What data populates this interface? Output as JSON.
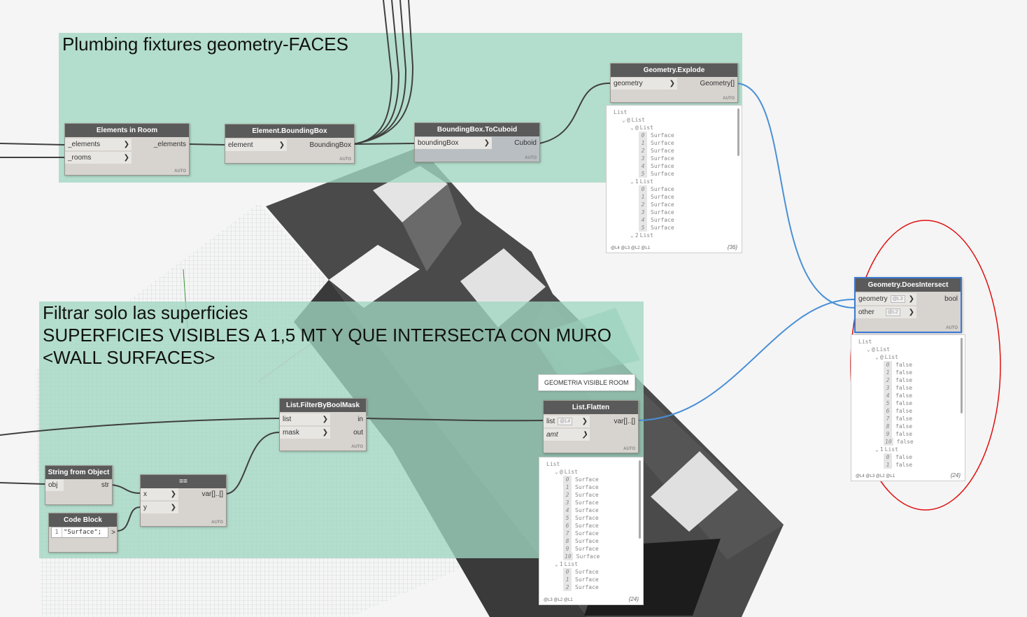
{
  "groups": {
    "top": {
      "title": "Plumbing fixtures geometry-FACES",
      "color": "#a0d6c2"
    },
    "bottom": {
      "title": "Filtrar solo las superficies\nSUPERFICIES VISIBLES A 1,5 MT Y QUE INTERSECTA CON MURO\n<WALL SURFACES>",
      "color": "#a0d6c2"
    }
  },
  "nodes": {
    "elements_in_room": {
      "title": "Elements in Room",
      "inputs": [
        "_elements",
        "_rooms"
      ],
      "outputs": [
        "_elements"
      ],
      "lacing": "AUTO"
    },
    "element_bbox": {
      "title": "Element.BoundingBox",
      "inputs": [
        "element"
      ],
      "outputs": [
        "BoundingBox"
      ],
      "lacing": "AUTO"
    },
    "bbox_cuboid": {
      "title": "BoundingBox.ToCuboid",
      "inputs": [
        "boundingBox"
      ],
      "outputs": [
        "Cuboid"
      ],
      "lacing": "AUTO"
    },
    "geom_explode": {
      "title": "Geometry.Explode",
      "inputs": [
        "geometry"
      ],
      "outputs": [
        "Geometry[]"
      ],
      "lacing": "AUTO"
    },
    "geom_intersect": {
      "title": "Geometry.DoesIntersect",
      "inputs": [
        "geometry",
        "other"
      ],
      "input_levels": [
        "@L3",
        "@L2"
      ],
      "outputs": [
        "bool"
      ],
      "lacing": "AUTO"
    },
    "filter_mask": {
      "title": "List.FilterByBoolMask",
      "inputs": [
        "list",
        "mask"
      ],
      "outputs": [
        "in",
        "out"
      ],
      "lacing": "AUTO"
    },
    "flatten": {
      "title": "List.Flatten",
      "inputs": [
        "list",
        "amt"
      ],
      "input_levels": [
        "@L4",
        ""
      ],
      "outputs": [
        "var[]..[]"
      ],
      "lacing": "AUTO"
    },
    "string_obj": {
      "title": "String from Object",
      "inputs": [
        "obj"
      ],
      "outputs": [
        "str"
      ]
    },
    "equals": {
      "title": "==",
      "inputs": [
        "x",
        "y"
      ],
      "outputs": [
        "var[]..[]"
      ],
      "lacing": "AUTO"
    },
    "code_block": {
      "title": "Code Block",
      "line_no": "1",
      "code": "\"Surface\";",
      "output": ">"
    }
  },
  "note": "GEOMETRIA VISIBLE ROOM",
  "previews": {
    "explode": {
      "lines": [
        {
          "d": 0,
          "t": "List"
        },
        {
          "d": 1,
          "a": "v",
          "i": "@",
          "t": "List"
        },
        {
          "d": 2,
          "a": "v",
          "i": "@",
          "t": "List"
        },
        {
          "d": 3,
          "i": "0",
          "t": "Surface"
        },
        {
          "d": 3,
          "i": "1",
          "t": "Surface"
        },
        {
          "d": 3,
          "i": "2",
          "t": "Surface"
        },
        {
          "d": 3,
          "i": "3",
          "t": "Surface"
        },
        {
          "d": 3,
          "i": "4",
          "t": "Surface"
        },
        {
          "d": 3,
          "i": "5",
          "t": "Surface"
        },
        {
          "d": 2,
          "a": "v",
          "i": "1",
          "t": "List"
        },
        {
          "d": 3,
          "i": "0",
          "t": "Surface"
        },
        {
          "d": 3,
          "i": "1",
          "t": "Surface"
        },
        {
          "d": 3,
          "i": "2",
          "t": "Surface"
        },
        {
          "d": 3,
          "i": "3",
          "t": "Surface"
        },
        {
          "d": 3,
          "i": "4",
          "t": "Surface"
        },
        {
          "d": 3,
          "i": "5",
          "t": "Surface"
        },
        {
          "d": 2,
          "a": "v",
          "i": "2",
          "t": "List"
        }
      ],
      "levels": "@L4 @L3 @L2 @L1",
      "count": "{36}"
    },
    "intersect": {
      "lines": [
        {
          "d": 0,
          "t": "List"
        },
        {
          "d": 1,
          "a": "v",
          "i": "@",
          "t": "List"
        },
        {
          "d": 2,
          "a": "v",
          "i": "@",
          "t": "List"
        },
        {
          "d": 3,
          "i": "0",
          "t": "false"
        },
        {
          "d": 3,
          "i": "1",
          "t": "false"
        },
        {
          "d": 3,
          "i": "2",
          "t": "false"
        },
        {
          "d": 3,
          "i": "3",
          "t": "false"
        },
        {
          "d": 3,
          "i": "4",
          "t": "false"
        },
        {
          "d": 3,
          "i": "5",
          "t": "false"
        },
        {
          "d": 3,
          "i": "6",
          "t": "false"
        },
        {
          "d": 3,
          "i": "7",
          "t": "false"
        },
        {
          "d": 3,
          "i": "8",
          "t": "false"
        },
        {
          "d": 3,
          "i": "9",
          "t": "false"
        },
        {
          "d": 3,
          "i": "10",
          "t": "false"
        },
        {
          "d": 2,
          "a": "v",
          "i": "1",
          "t": "List"
        },
        {
          "d": 3,
          "i": "0",
          "t": "false"
        },
        {
          "d": 3,
          "i": "1",
          "t": "false"
        }
      ],
      "levels": "@L4 @L3 @L2 @L1",
      "count": "{24}"
    },
    "flatten": {
      "lines": [
        {
          "d": 0,
          "t": "List"
        },
        {
          "d": 1,
          "a": "v",
          "i": "@",
          "t": "List"
        },
        {
          "d": 2,
          "i": "0",
          "t": "Surface"
        },
        {
          "d": 2,
          "i": "1",
          "t": "Surface"
        },
        {
          "d": 2,
          "i": "2",
          "t": "Surface"
        },
        {
          "d": 2,
          "i": "3",
          "t": "Surface"
        },
        {
          "d": 2,
          "i": "4",
          "t": "Surface"
        },
        {
          "d": 2,
          "i": "5",
          "t": "Surface"
        },
        {
          "d": 2,
          "i": "6",
          "t": "Surface"
        },
        {
          "d": 2,
          "i": "7",
          "t": "Surface"
        },
        {
          "d": 2,
          "i": "8",
          "t": "Surface"
        },
        {
          "d": 2,
          "i": "9",
          "t": "Surface"
        },
        {
          "d": 2,
          "i": "10",
          "t": "Surface"
        },
        {
          "d": 1,
          "a": "v",
          "i": "1",
          "t": "List"
        },
        {
          "d": 2,
          "i": "0",
          "t": "Surface"
        },
        {
          "d": 2,
          "i": "1",
          "t": "Surface"
        },
        {
          "d": 2,
          "i": "2",
          "t": "Surface"
        }
      ],
      "levels": "@L3 @L2 @L1",
      "count": "{24}"
    }
  },
  "colors": {
    "selection_wire": "#4a8fd6",
    "highlight_circle": "#e01010",
    "node_header": "#5a5a5a"
  }
}
